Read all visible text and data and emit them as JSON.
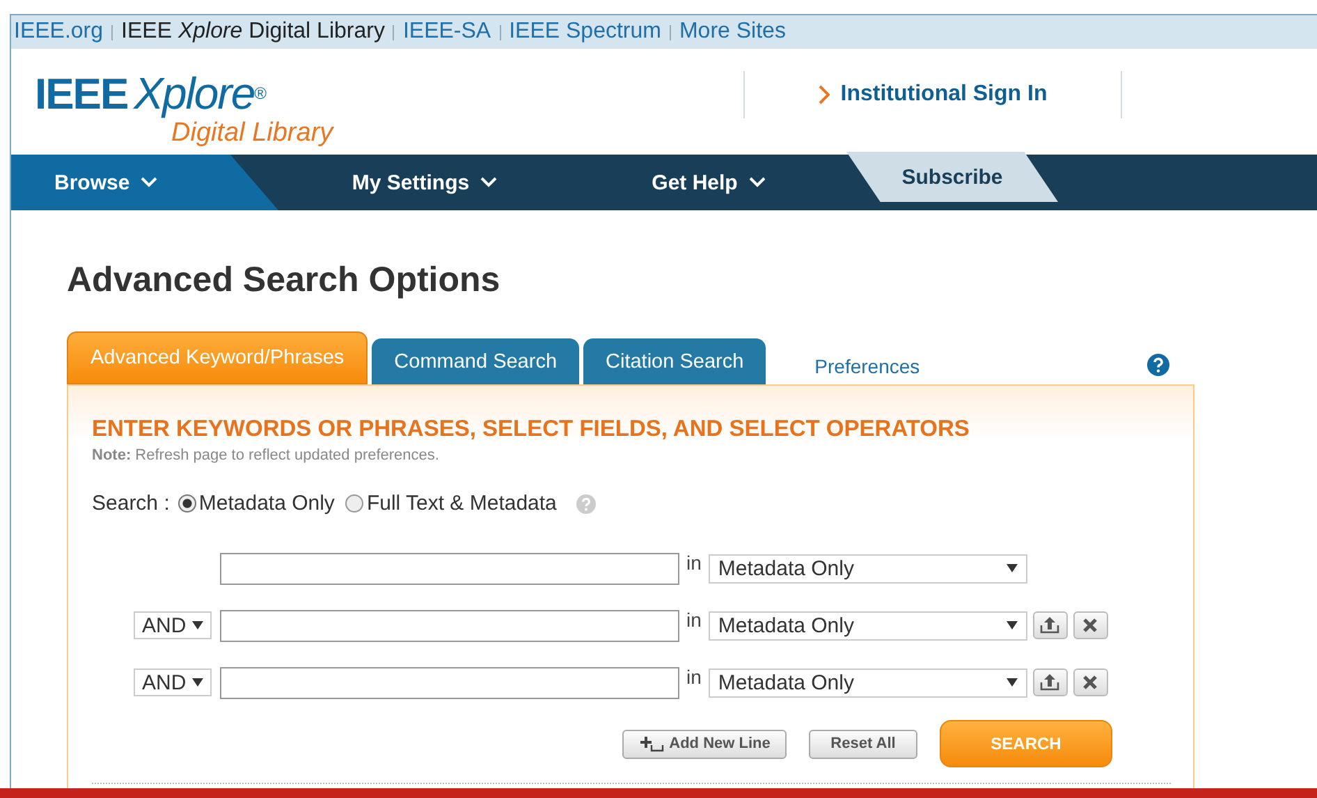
{
  "top_links": [
    {
      "label": "IEEE.org",
      "kind": "link"
    },
    {
      "label": "IEEE *Xplore* Digital Library",
      "kind": "current"
    },
    {
      "label": "IEEE-SA",
      "kind": "link"
    },
    {
      "label": "IEEE Spectrum",
      "kind": "link"
    },
    {
      "label": "More Sites",
      "kind": "link"
    }
  ],
  "logo": {
    "brand": "IEEE",
    "product": "Xplore",
    "mark": "®",
    "subtitle": "Digital Library"
  },
  "sign_in": "Institutional Sign In",
  "nav": [
    {
      "label": "Browse",
      "kind": "dropdown",
      "selected": true
    },
    {
      "label": "My Settings",
      "kind": "dropdown",
      "selected": false
    },
    {
      "label": "Get Help",
      "kind": "dropdown",
      "selected": false
    },
    {
      "label": "Subscribe",
      "kind": "subscribe",
      "selected": false
    }
  ],
  "page_title": "Advanced Search Options",
  "tabs": [
    {
      "label": "Advanced Keyword/Phrases",
      "selected": true
    },
    {
      "label": "Command Search",
      "selected": false
    },
    {
      "label": "Citation Search",
      "selected": false
    }
  ],
  "preferences_link": "Preferences",
  "panel": {
    "heading": "ENTER KEYWORDS OR PHRASES, SELECT FIELDS, AND SELECT OPERATORS",
    "note": "**Note:** Refresh page to reflect updated preferences.",
    "search_label": "Search :",
    "scope_options": [
      {
        "label": "Metadata Only",
        "selected": true
      },
      {
        "label": "Full Text & Metadata",
        "selected": false
      }
    ],
    "rows": [
      {
        "kind": "first",
        "in_label": "in",
        "field": "Metadata Only"
      },
      {
        "kind": "extra",
        "operator": "AND",
        "in_label": "in",
        "field": "Metadata Only"
      },
      {
        "kind": "extra",
        "operator": "AND",
        "in_label": "in",
        "field": "Metadata Only"
      }
    ],
    "buttons": [
      {
        "kind": "add",
        "label": "Add New Line"
      },
      {
        "kind": "reset",
        "label": "Reset All"
      },
      {
        "kind": "primary",
        "label": "SEARCH"
      }
    ]
  }
}
